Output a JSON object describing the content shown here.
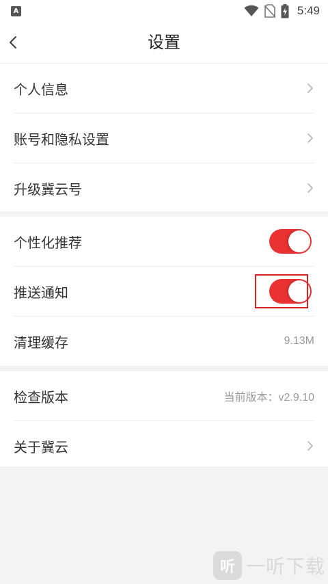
{
  "status_bar": {
    "left_icon": "A",
    "left_icon_name": "keyboard-a-icon",
    "icons": [
      "wifi-icon",
      "no-sim-icon",
      "battery-charging-icon"
    ],
    "time": "5:49"
  },
  "header": {
    "title": "设置",
    "back_icon": "chevron-left-icon"
  },
  "section1": {
    "items": [
      {
        "label": "个人信息",
        "icon": "chevron-right-icon"
      },
      {
        "label": "账号和隐私设置",
        "icon": "chevron-right-icon"
      },
      {
        "label": "升级冀云号",
        "icon": "chevron-right-icon"
      }
    ]
  },
  "section2": {
    "items": [
      {
        "label": "个性化推荐",
        "toggle": true
      },
      {
        "label": "推送通知",
        "toggle": true
      },
      {
        "label": "清理缓存",
        "value": "9.13M"
      }
    ]
  },
  "section3": {
    "items": [
      {
        "label": "检查版本",
        "value": "当前版本：v2.9.10"
      },
      {
        "label": "关于冀云",
        "icon": "chevron-right-icon"
      }
    ]
  },
  "colors": {
    "accent": "#ea3232",
    "background": "#f3f3f3",
    "highlight": "#e02020"
  },
  "watermark": {
    "logo_text": "听",
    "text": "一听下载"
  }
}
